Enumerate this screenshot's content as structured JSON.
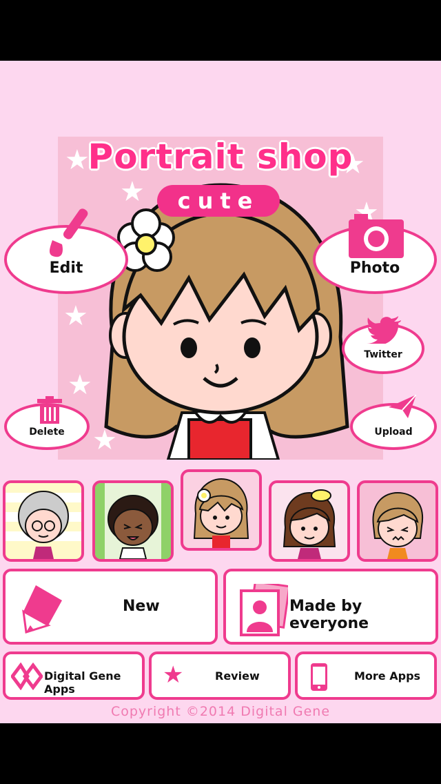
{
  "app": {
    "title": "Portrait shop",
    "subtitle": "cute"
  },
  "actions": {
    "edit": "Edit",
    "photo": "Photo",
    "twitter": "Twitter",
    "delete": "Delete",
    "upload": "Upload"
  },
  "buttons": {
    "new": "New",
    "made_by_everyone": "Made by everyone",
    "digital_gene_apps": "Digital Gene Apps",
    "review": "Review",
    "more_apps": "More Apps"
  },
  "footer": {
    "copyright": "Copyright  ©2014 Digital Gene"
  },
  "colors": {
    "accent": "#ef3b8e",
    "background": "#fdd7ef",
    "hero_background": "#f7bfd6"
  },
  "icons": {
    "edit": "paintbrush-icon",
    "photo": "camera-icon",
    "twitter": "twitter-bird-icon",
    "delete": "trash-icon",
    "upload": "paper-plane-icon",
    "new": "pencil-icon",
    "made_by_everyone": "person-photos-icon",
    "digital_gene_apps": "digital-gene-logo-icon",
    "review": "star-icon",
    "more_apps": "smartphone-icon"
  }
}
